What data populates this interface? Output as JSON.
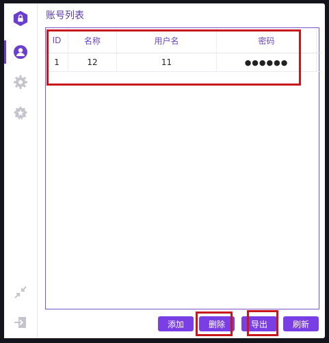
{
  "title": "账号列表",
  "table": {
    "headers": [
      "ID",
      "名称",
      "用户名",
      "密码"
    ],
    "rows": [
      {
        "id": "1",
        "name": "12",
        "username": "11",
        "password": "●●●●●●"
      }
    ]
  },
  "buttons": {
    "add": "添加",
    "delete": "删除",
    "export": "导出",
    "refresh": "刷新"
  },
  "icons": {
    "app": "lock-hexagon-icon",
    "user": "user-icon",
    "settings": "gear-icon",
    "badge": "badge-icon",
    "collapse": "shrink-icon",
    "logout": "logout-icon"
  },
  "colors": {
    "accent": "#7a3fe4",
    "highlight": "#c8161d"
  }
}
